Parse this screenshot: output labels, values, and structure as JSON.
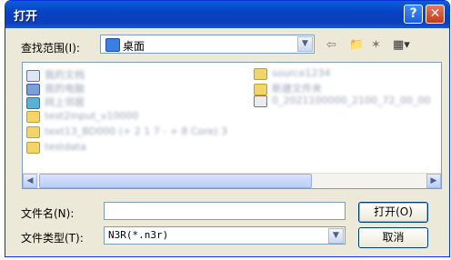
{
  "window": {
    "title": "打开",
    "help_label": "?",
    "close_label": "✕"
  },
  "lookin": {
    "label": "查找范围(I):",
    "value": "桌面"
  },
  "toolbar_icons": [
    "back-icon",
    "up-folder-icon",
    "new-folder-icon",
    "view-menu-icon"
  ],
  "files": [
    {
      "name": "我的文档",
      "icon": "doc-icon"
    },
    {
      "name": "我的电脑",
      "icon": "computer-icon"
    },
    {
      "name": "网上邻居",
      "icon": "network-icon"
    },
    {
      "name": "test2input_v10000",
      "icon": "folder-icon"
    },
    {
      "name": "text13_BD000 (+ 2 1 7 - + 8 Core) 3",
      "icon": "folder-icon"
    },
    {
      "name": "testdata",
      "icon": "folder-icon"
    },
    {
      "name": "source1234",
      "icon": "folder-icon"
    },
    {
      "name": "新建文件夹",
      "icon": "folder-icon"
    },
    {
      "name": "0_2021100000_2100_72_00_00",
      "icon": "file-icon"
    }
  ],
  "filename": {
    "label": "文件名(N):",
    "value": ""
  },
  "filetype": {
    "label": "文件类型(T):",
    "value": "N3R(*.n3r)"
  },
  "buttons": {
    "open": "打开(O)",
    "cancel": "取消"
  }
}
